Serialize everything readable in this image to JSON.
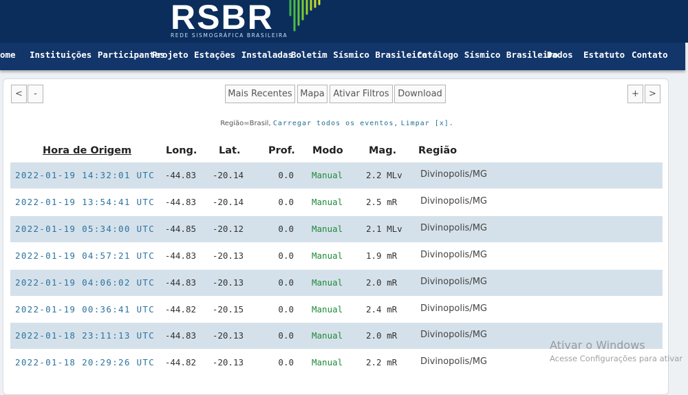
{
  "header": {
    "logo": "RSBR",
    "logo_subtitle": "REDE SISMOGRÁFICA BRASILEIRA"
  },
  "nav": {
    "items": [
      "ome",
      "Instituições Participantes",
      "Projeto",
      "Estações Instaladas",
      "Boletim Sísmico Brasileiro",
      "Catálogo Sísmico Brasileiro",
      "Dados",
      "Estatuto",
      "Contato"
    ]
  },
  "toolbar": {
    "prev": "<",
    "minus": "-",
    "recent": "Mais Recentes",
    "map": "Mapa",
    "filters": "Ativar Filtros",
    "download": "Download",
    "plus": "+",
    "next": ">"
  },
  "filter": {
    "region": "Região=Brasil,",
    "load_all": "Carregar todos os eventos,",
    "clear": "Limpar [x]."
  },
  "table": {
    "headers": {
      "time": "Hora de Origem",
      "lon": "Long.",
      "lat": "Lat.",
      "depth": "Prof.",
      "mode": "Modo",
      "mag": "Mag.",
      "region": "Região"
    },
    "rows": [
      {
        "time": "2022-01-19 14:32:01 UTC",
        "lon": "-44.83",
        "lat": "-20.14",
        "depth": "0.0",
        "mode": "Manual",
        "mag": "2.2 MLv",
        "region": "Divinopolis/MG"
      },
      {
        "time": "2022-01-19 13:54:41 UTC",
        "lon": "-44.83",
        "lat": "-20.14",
        "depth": "0.0",
        "mode": "Manual",
        "mag": "2.5 mR",
        "region": "Divinopolis/MG"
      },
      {
        "time": "2022-01-19 05:34:00 UTC",
        "lon": "-44.85",
        "lat": "-20.12",
        "depth": "0.0",
        "mode": "Manual",
        "mag": "2.1 MLv",
        "region": "Divinopolis/MG"
      },
      {
        "time": "2022-01-19 04:57:21 UTC",
        "lon": "-44.83",
        "lat": "-20.13",
        "depth": "0.0",
        "mode": "Manual",
        "mag": "1.9 mR",
        "region": "Divinopolis/MG"
      },
      {
        "time": "2022-01-19 04:06:02 UTC",
        "lon": "-44.83",
        "lat": "-20.13",
        "depth": "0.0",
        "mode": "Manual",
        "mag": "2.0 mR",
        "region": "Divinopolis/MG"
      },
      {
        "time": "2022-01-19 00:36:41 UTC",
        "lon": "-44.82",
        "lat": "-20.15",
        "depth": "0.0",
        "mode": "Manual",
        "mag": "2.4 mR",
        "region": "Divinopolis/MG"
      },
      {
        "time": "2022-01-18 23:11:13 UTC",
        "lon": "-44.83",
        "lat": "-20.13",
        "depth": "0.0",
        "mode": "Manual",
        "mag": "2.0 mR",
        "region": "Divinopolis/MG"
      },
      {
        "time": "2022-01-18 20:29:26 UTC",
        "lon": "-44.82",
        "lat": "-20.13",
        "depth": "0.0",
        "mode": "Manual",
        "mag": "2.2 mR",
        "region": "Divinopolis/MG"
      }
    ]
  },
  "watermark": {
    "title": "Ativar o Windows",
    "subtitle": "Acesse Configurações para ativar"
  }
}
